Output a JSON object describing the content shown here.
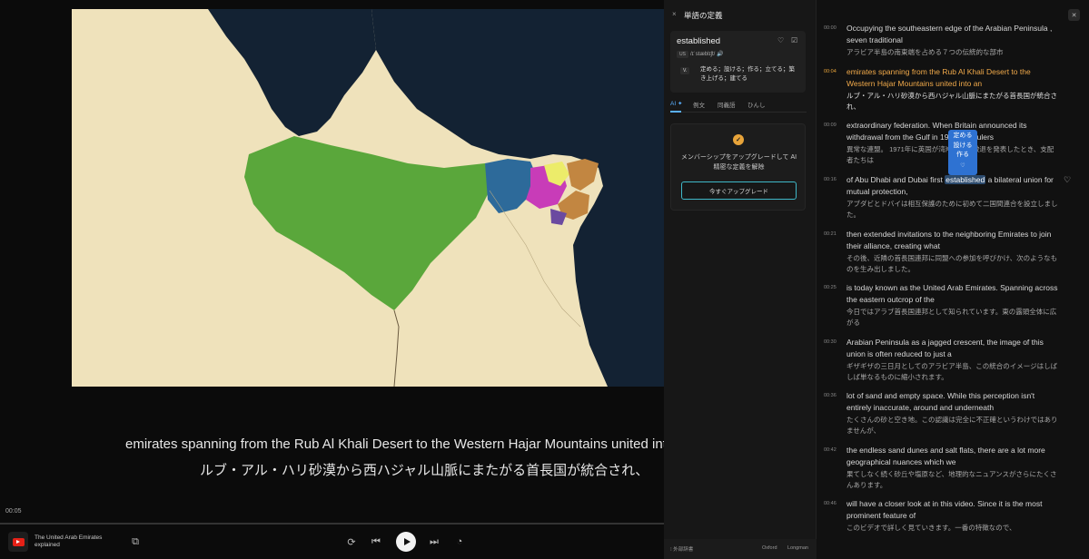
{
  "video": {
    "subtitle_en": "emirates spanning from the Rub Al Khali Desert to the Western Hajar Mountains united into a",
    "subtitle_ja": "ルブ・アル・ハリ砂漠から西ハジャル山脈にまたがる首長国が統合され、",
    "current_time": "00:05",
    "progress": 0.0,
    "title": "The United Arab Emirates explained",
    "icons": [
      "youtube-icon",
      "external-icon",
      "loop-icon",
      "prev-icon",
      "play-icon",
      "next-icon",
      "speed-icon"
    ]
  },
  "dictionary": {
    "close_label": "×",
    "title": "単語の定義",
    "word": "established",
    "region": "US",
    "ipa": "/ɪˈstæblɪʃt/ 🔊",
    "pos": "V.",
    "definition": "定める；設ける；作る；立てる；築き上げる；建てる",
    "tabs": [
      "AI ✦",
      "例文",
      "同義語",
      "ひんし"
    ],
    "upgrade_text": "メンバーシップをアップグレードして AI 精密な定義を解除",
    "upgrade_button": "今すぐアップグレード",
    "footer_ext": "⁝ 外部辞書",
    "footer_oxford": "Oxford",
    "footer_longman": "Longman"
  },
  "transcript": {
    "close_label": "✕",
    "popup": [
      "定める",
      "設ける",
      "作る"
    ],
    "segments": [
      {
        "ts": "00:00",
        "en": "Occupying the southeastern edge of the Arabian Peninsula , seven traditional",
        "ja": "アラビア半島の南東端を占める７つの伝統的な部市"
      },
      {
        "ts": "00:04",
        "en": "emirates spanning from the Rub Al Khali Desert to the Western Hajar Mountains united into an",
        "ja": "ルブ・アル・ハリ砂漠から西ハジャル山脈にまたがる首長国が統合され、"
      },
      {
        "ts": "00:09",
        "en": "extraordinary federation. When Britain announced its withdrawal from the Gulf in 1968, the rulers",
        "ja": "異常な連盟。 1971年に英国が湾岸からの撤退を発表したとき、支配者たちは"
      },
      {
        "ts": "00:16",
        "en_pre": "of Abu Dhabi and Dubai first ",
        "en_hl": "established",
        "en_post": " a bilateral union for mutual protection,",
        "ja": "アブダビとドバイは相互保護のために初めて二国間連合を設立しました。"
      },
      {
        "ts": "00:21",
        "en": "then extended invitations to the neighboring Emirates to join their alliance, creating what",
        "ja": "その後、近隣の首長国連邦に同盟への参加を呼びかけ、次のようなものを生み出しました。"
      },
      {
        "ts": "00:25",
        "en": "is today known as the United Arab Emirates. Spanning across the eastern outcrop of the",
        "ja": "今日ではアラブ首長国連邦として知られています。東の露頭全体に広がる"
      },
      {
        "ts": "00:30",
        "en": "Arabian Peninsula as a jagged crescent, the image of this union is often reduced to just a",
        "ja": "ギザギザの三日月としてのアラビア半島、この統合のイメージはしばしば単なるものに縮小されます。"
      },
      {
        "ts": "00:36",
        "en": "lot of sand and empty space. While this perception isn't entirely inaccurate, around and underneath",
        "ja": "たくさんの砂と空き地。この認識は完全に不正確というわけではありませんが、"
      },
      {
        "ts": "00:42",
        "en": "the endless sand dunes and salt flats, there are a lot more geographical nuances which we",
        "ja": "果てしなく続く砂丘や塩原など、地理的なニュアンスがさらにたくさんあります。"
      },
      {
        "ts": "00:46",
        "en": "will have a closer look at in this video. Since it is the most prominent feature of",
        "ja": "このビデオで詳しく見ていきます。一番の特徴なので、"
      }
    ]
  }
}
